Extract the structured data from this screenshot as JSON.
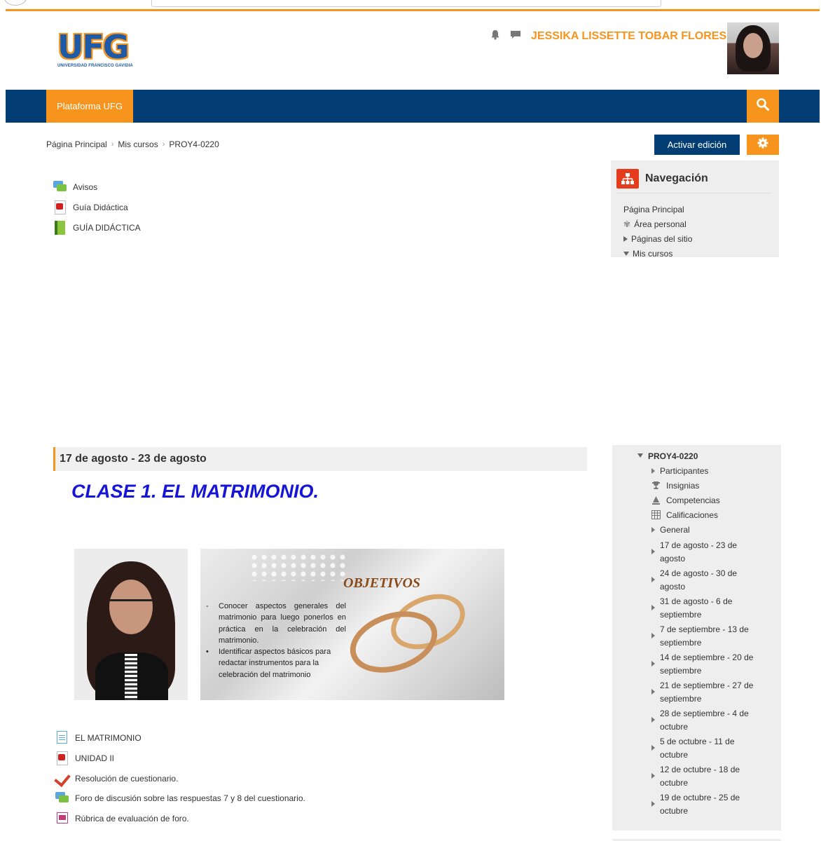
{
  "header": {
    "logo_text": "UFG",
    "logo_subtitle": "UNIVERSIDAD FRANCISCO GAVIDIA",
    "user_name": "JESSIKA LISSETTE TOBAR FLORES",
    "icons": [
      "bell-icon",
      "chat-icon",
      "caret-down-icon"
    ]
  },
  "navbar": {
    "item_label": "Plataforma UFG",
    "search_icon": "search-icon"
  },
  "breadcrumb": {
    "items": [
      "Página Principal",
      "Mis cursos",
      "PROY4-0220"
    ]
  },
  "actions": {
    "edit_label": "Activar edición",
    "gear_icon": "gear-icon"
  },
  "resources": [
    {
      "label": "Avisos",
      "icon": "forum-icon"
    },
    {
      "label": "Guía Didáctica",
      "icon": "pdf-icon"
    },
    {
      "label": "GUÍA DIDÁCTICA",
      "icon": "book-icon"
    }
  ],
  "navigation_block": {
    "title": "Navegación",
    "items": [
      "Página Principal",
      "Área personal",
      "Páginas del sitio",
      "Mis cursos"
    ]
  },
  "section": {
    "heading": "17 de agosto - 23 de agosto",
    "class_title": "CLASE 1. EL MATRIMONIO.",
    "objectives_title": "OBJETIVOS",
    "objectives": [
      "Conocer aspectos generales del matrimonio para luego ponerlos en práctica en la celebración del matrimonio.",
      "Identificar aspectos básicos para redactar instrumentos para la celebración del matrimonio"
    ],
    "activities": [
      {
        "label": "EL MATRIMONIO",
        "icon": "page-icon"
      },
      {
        "label": "UNIDAD II",
        "icon": "pdf-icon"
      },
      {
        "label": "Resolución de cuestionario.",
        "icon": "quiz-icon"
      },
      {
        "label": "Foro de discusión sobre las respuestas 7 y 8 del cuestionario.",
        "icon": "forum-icon"
      },
      {
        "label": "Rúbrica de evaluación de foro.",
        "icon": "image-icon"
      }
    ]
  },
  "course_block": {
    "course": "PROY4-0220",
    "items": [
      "Participantes",
      "Insignias",
      "Competencias",
      "Calificaciones",
      "General",
      "17 de agosto - 23 de agosto",
      "24 de agosto - 30 de agosto",
      "31 de agosto - 6 de septiembre",
      "7 de septiembre - 13 de septiembre",
      "14 de septiembre - 20 de septiembre",
      "21 de septiembre - 27 de septiembre",
      "28 de septiembre - 4 de octubre",
      "5 de octubre - 11 de octubre",
      "12 de octubre - 18 de octubre",
      "19 de octubre - 25 de octubre"
    ]
  },
  "colors": {
    "brand_orange": "#f7941d",
    "brand_blue": "#023e74",
    "title_blue": "#1515d6"
  }
}
